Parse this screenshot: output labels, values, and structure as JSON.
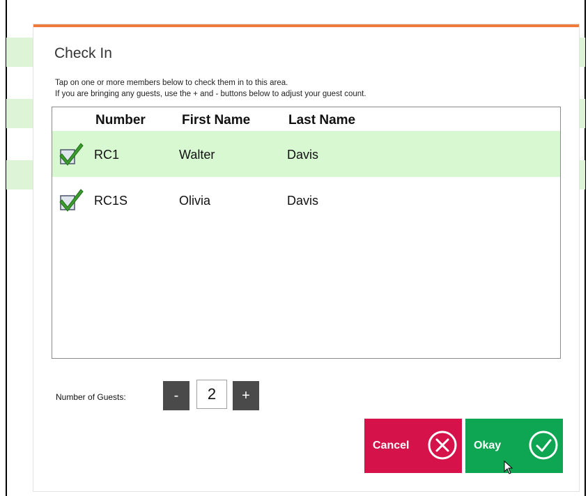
{
  "dialog": {
    "title": "Check In",
    "instructions": [
      "Tap on one or more members below to check them in to this area.",
      "If you are bringing any guests, use the + and - buttons below to adjust your guest count."
    ],
    "accent_color": "#ef7c3c"
  },
  "table": {
    "columns": [
      "Number",
      "First Name",
      "Last Name"
    ],
    "rows": [
      {
        "number": "RC1",
        "first_name": "Walter",
        "last_name": "Davis",
        "checked": true,
        "selected": true
      },
      {
        "number": "RC1S",
        "first_name": "Olivia",
        "last_name": "Davis",
        "checked": true,
        "selected": false
      }
    ],
    "selected_row_color": "#d8f8d2"
  },
  "guests": {
    "label": "Number of Guests:",
    "minus_label": "-",
    "plus_label": "+",
    "value": "2"
  },
  "actions": {
    "cancel_label": "Cancel",
    "cancel_color": "#d6124a",
    "okay_label": "Okay",
    "okay_color": "#0fa653"
  }
}
